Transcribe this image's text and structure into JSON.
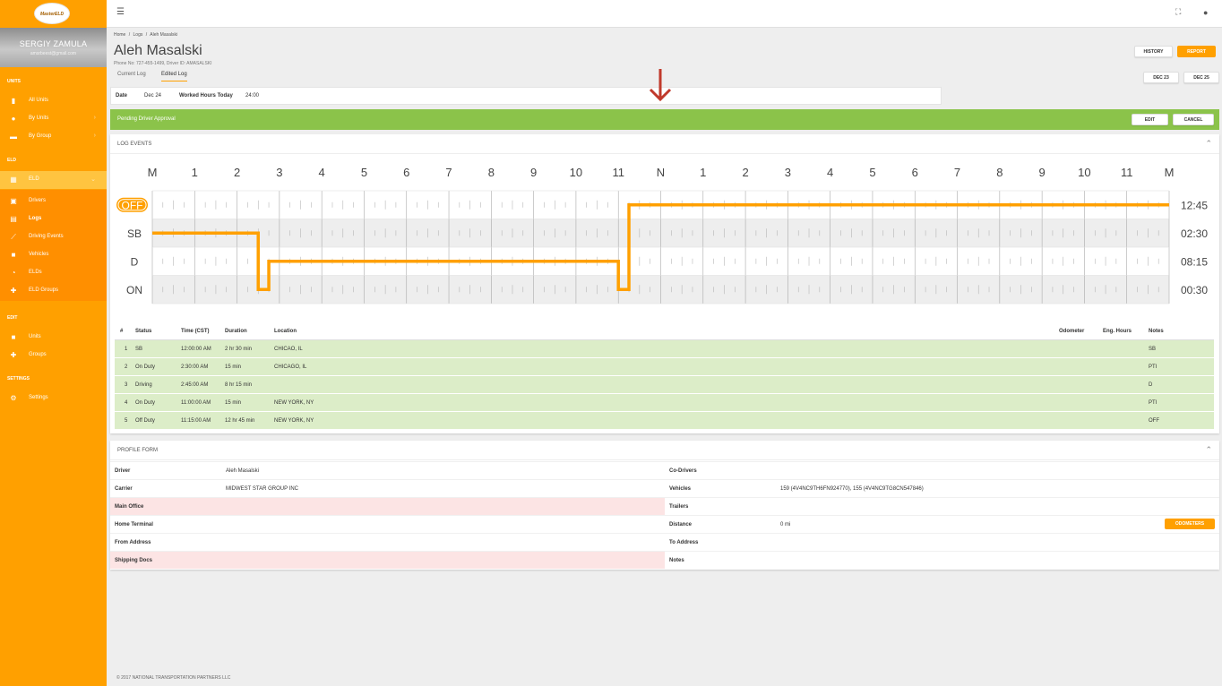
{
  "sidebar": {
    "logo_text": "MasterELD",
    "user_name": "SERGIY ZAMULA",
    "user_email": "amsrbeest@gmail.com",
    "sections": {
      "units": "UNITS",
      "eld": "ELD",
      "edit": "EDIT",
      "settings": "SETTINGS"
    },
    "items": {
      "all_units": "All Units",
      "by_units": "By Units",
      "by_group": "By Group",
      "eld": "ELD",
      "drivers": "Drivers",
      "logs": "Logs",
      "driving_events": "Driving Events",
      "vehicles": "Vehicles",
      "elds": "ELDs",
      "eld_groups": "ELD Groups",
      "units": "Units",
      "groups": "Groups",
      "settings": "Settings"
    }
  },
  "breadcrumb": {
    "home": "Home",
    "sep": "/",
    "logs": "Logs",
    "current": "Aleh Masalski"
  },
  "page": {
    "title": "Aleh Masalski",
    "subtitle": "Phone No: 727-455-1499, Driver ID: AMASALSKI",
    "history_btn": "HISTORY",
    "report_btn": "REPORT",
    "prev_day_btn": "DEC 23",
    "next_day_btn": "DEC 25"
  },
  "tabs": {
    "current": "Current Log",
    "edited": "Edited Log"
  },
  "date_bar": {
    "date_label": "Date",
    "date_value": "Dec 24",
    "hours_label": "Worked Hours Today",
    "hours_value": "24:00"
  },
  "pending": {
    "text": "Pending Driver Approval",
    "edit_btn": "EDIT",
    "cancel_btn": "CANCEL"
  },
  "log_events": {
    "title": "LOG EVENTS",
    "hour_labels": [
      "M",
      "1",
      "2",
      "3",
      "4",
      "5",
      "6",
      "7",
      "8",
      "9",
      "10",
      "11",
      "N",
      "1",
      "2",
      "3",
      "4",
      "5",
      "6",
      "7",
      "8",
      "9",
      "10",
      "11",
      "M"
    ],
    "rows": [
      "OFF",
      "SB",
      "D",
      "ON"
    ],
    "totals": [
      "12:45",
      "02:30",
      "08:15",
      "00:30"
    ],
    "active_row": "OFF",
    "segments": [
      {
        "status": "SB",
        "start": 0,
        "end": 2.5
      },
      {
        "status": "ON",
        "start": 2.5,
        "end": 2.75
      },
      {
        "status": "D",
        "start": 2.75,
        "end": 11
      },
      {
        "status": "ON",
        "start": 11,
        "end": 11.25
      },
      {
        "status": "OFF",
        "start": 11.25,
        "end": 24
      }
    ],
    "colors": {
      "line": "#ffa000",
      "grid": "#aaaaaa",
      "band": "#eeeeee"
    }
  },
  "events_table": {
    "headers": {
      "num": "#",
      "status": "Status",
      "time": "Time (CST)",
      "duration": "Duration",
      "location": "Location",
      "odometer": "Odometer",
      "eng_hours": "Eng. Hours",
      "notes": "Notes"
    },
    "rows": [
      {
        "num": "1",
        "status": "SB",
        "time": "12:00:00 AM",
        "duration": "2 hr 30 min",
        "location": "CHICAO, IL",
        "notes": "SB"
      },
      {
        "num": "2",
        "status": "On Duty",
        "time": "2:30:00 AM",
        "duration": "15 min",
        "location": "CHICAGO, IL",
        "notes": "PTI"
      },
      {
        "num": "3",
        "status": "Driving",
        "time": "2:45:00 AM",
        "duration": "8 hr 15 min",
        "location": "",
        "notes": "D"
      },
      {
        "num": "4",
        "status": "On Duty",
        "time": "11:00:00 AM",
        "duration": "15 min",
        "location": "NEW YORK, NY",
        "notes": "PTI"
      },
      {
        "num": "5",
        "status": "Off Duty",
        "time": "11:15:00 AM",
        "duration": "12 hr 45 min",
        "location": "NEW YORK, NY",
        "notes": "OFF"
      }
    ]
  },
  "profile": {
    "title": "PROFILE FORM",
    "left": [
      {
        "label": "Driver",
        "value": "Aleh Masalski"
      },
      {
        "label": "Carrier",
        "value": "MIDWEST STAR GROUP INC"
      },
      {
        "label": "Main Office",
        "value": ""
      },
      {
        "label": "Home Terminal",
        "value": ""
      },
      {
        "label": "From Address",
        "value": ""
      },
      {
        "label": "Shipping Docs",
        "value": ""
      }
    ],
    "right": [
      {
        "label": "Co-Drivers",
        "value": ""
      },
      {
        "label": "Vehicles",
        "value": "159 (4V4NC9TH6FN924770), 155 (4V4NC9TG8CN547846)"
      },
      {
        "label": "Trailers",
        "value": ""
      },
      {
        "label": "Distance",
        "value": "0 mi"
      },
      {
        "label": "To Address",
        "value": ""
      },
      {
        "label": "Notes",
        "value": ""
      }
    ],
    "odometers_btn": "ODOMETERS"
  },
  "footer": "© 2017 NATIONAL TRANSPORTATION PARTNERS LLC"
}
